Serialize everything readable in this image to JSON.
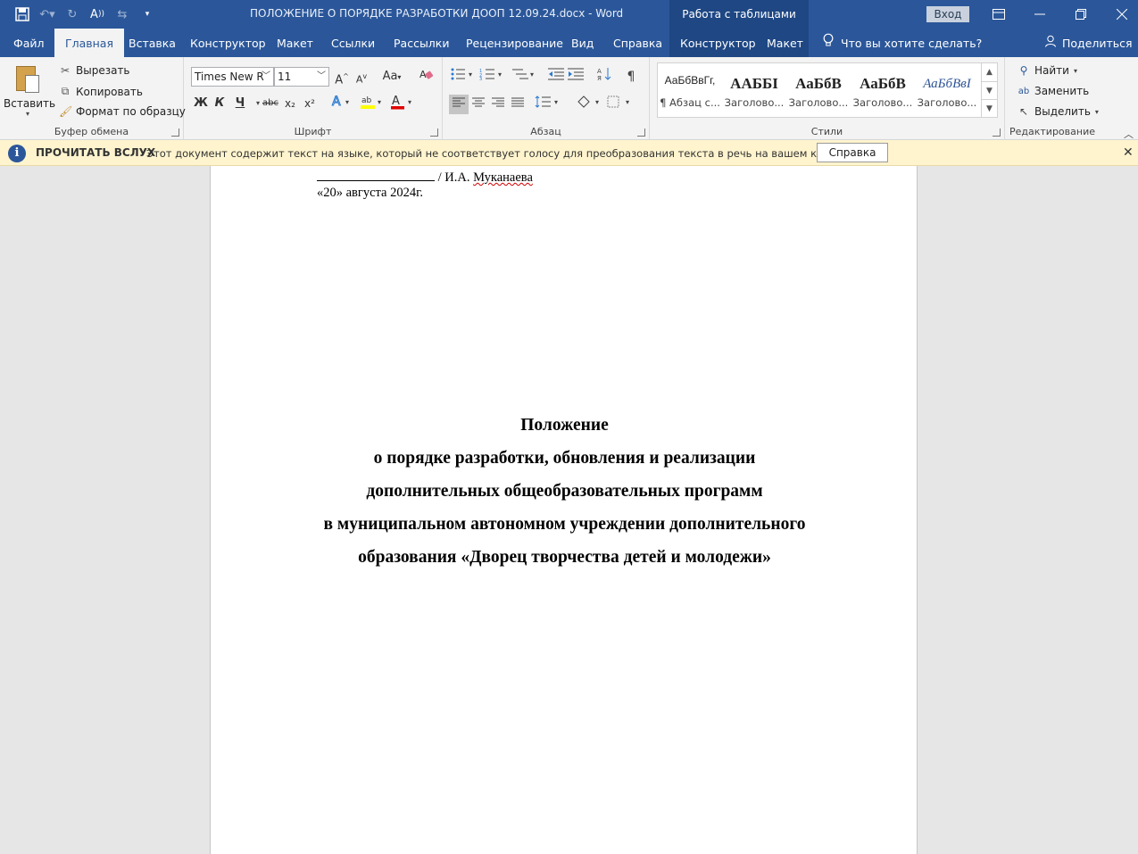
{
  "titlebar": {
    "document_title": "ПОЛОЖЕНИЕ О ПОРЯДКЕ РАЗРАБОТКИ ДООП 12.09.24.docx  -  Word",
    "context_tab_group": "Работа с таблицами",
    "signin_label": "Вход"
  },
  "menu": {
    "tabs": [
      "Файл",
      "Главная",
      "Вставка",
      "Конструктор",
      "Макет",
      "Ссылки",
      "Рассылки",
      "Рецензирование",
      "Вид",
      "Справка",
      "Конструктор",
      "Макет"
    ],
    "active_tab": "Главная",
    "tell_me": "Что вы хотите сделать?",
    "share": "Поделиться"
  },
  "ribbon": {
    "clipboard": {
      "label": "Буфер обмена",
      "paste": "Вставить",
      "cut": "Вырезать",
      "copy": "Копировать",
      "format_painter": "Формат по образцу"
    },
    "font": {
      "label": "Шрифт",
      "font_name": "Times New R",
      "font_size": "11",
      "bold": "Ж",
      "italic": "К",
      "underline": "Ч",
      "strike": "abc",
      "subscript": "x₂",
      "superscript": "x²",
      "grow": "A",
      "shrink": "A",
      "case": "Aa",
      "highlight_color": "#ffff00",
      "font_color": "#e00000"
    },
    "paragraph": {
      "label": "Абзац"
    },
    "styles": {
      "label": "Стили",
      "items": [
        {
          "sample": "АаБбВвГг,",
          "name": "¶ Абзац с..."
        },
        {
          "sample": "ААББІ",
          "name": "Заголово..."
        },
        {
          "sample": "АаБбВ",
          "name": "Заголово..."
        },
        {
          "sample": "АаБбВ",
          "name": "Заголово..."
        },
        {
          "sample": "АаБбВвІ",
          "name": "Заголово..."
        }
      ]
    },
    "editing": {
      "label": "Редактирование",
      "find": "Найти",
      "replace": "Заменить",
      "select": "Выделить"
    }
  },
  "infobar": {
    "title": "ПРОЧИТАТЬ ВСЛУХ",
    "message": "Этот документ содержит текст на языке, который не соответствует голосу для преобразования текста в речь на вашем компьютере.",
    "button": "Справка"
  },
  "document": {
    "signature_name": "/ И.А. Муканаева",
    "date": "«20» августа 2024г.",
    "heading_lines": [
      "Положение",
      "о порядке разработки, обновления и реализации",
      "дополнительных общеобразовательных программ",
      "в муниципальном автономном учреждении дополнительного",
      "образования «Дворец творчества детей и молодежи»"
    ]
  }
}
